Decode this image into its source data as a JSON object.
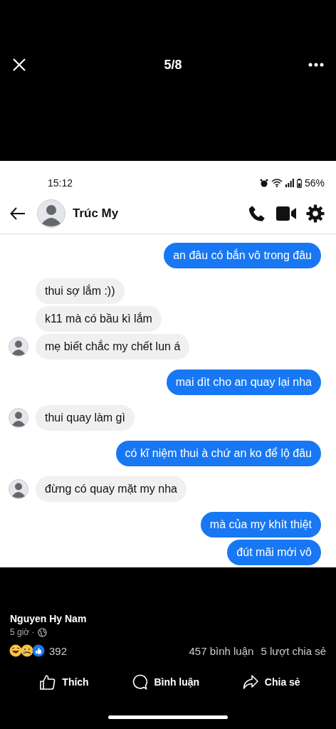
{
  "viewer": {
    "counter": "5/8"
  },
  "screenshot": {
    "status_bar": {
      "time": "15:12",
      "battery": "56%"
    },
    "chat_header": {
      "name": "Trúc My"
    },
    "messages": [
      {
        "kind": "sent",
        "text": "an đâu có bắn vô trong đâu"
      },
      {
        "kind": "received",
        "text": "thui sợ lắm :))",
        "avatar": false
      },
      {
        "kind": "received",
        "text": "k11 mà có bầu kì lắm",
        "avatar": false
      },
      {
        "kind": "received",
        "text": "mẹ biết chắc my chết lun á",
        "avatar": true
      },
      {
        "kind": "sent",
        "text": "mai dìt cho an quay lại nha"
      },
      {
        "kind": "received",
        "text": "thui quay làm gì",
        "avatar": true
      },
      {
        "kind": "sent",
        "text": "có kĩ niệm thui à chứ an ko để lộ đâu"
      },
      {
        "kind": "received",
        "text": "đừng có quay mặt my nha",
        "avatar": true
      },
      {
        "kind": "sent",
        "text": "mà của my khít thiệt"
      },
      {
        "kind": "sent",
        "text": "đút mãi mới vô"
      }
    ]
  },
  "post": {
    "author": "Nguyen Hy Nam",
    "time": "5 giờ ·",
    "reactions_count": "392",
    "comments": "457 bình luận",
    "shares": "5 lượt chia sẻ",
    "actions": [
      {
        "kind": "like",
        "label": "Thích"
      },
      {
        "kind": "comment",
        "label": "Bình luận"
      },
      {
        "kind": "share",
        "label": "Chia sẻ"
      }
    ]
  }
}
